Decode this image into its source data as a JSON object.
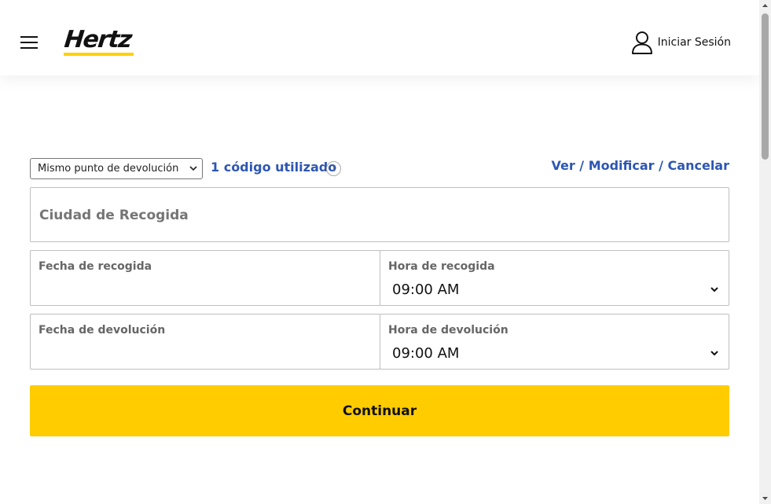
{
  "header": {
    "brand": "Hertz",
    "signin_label": "Iniciar Sesión"
  },
  "booking": {
    "return_option": "Mismo punto de devolución",
    "codes_used": "1 código utilizado",
    "manage_link": "Ver / Modificar / Cancelar",
    "pickup_city_placeholder": "Ciudad de Recogida",
    "pickup_date_label": "Fecha de recogida",
    "pickup_time_label": "Hora de recogida",
    "pickup_time_value": "09:00 AM",
    "return_date_label": "Fecha de devolución",
    "return_time_label": "Hora de devolución",
    "return_time_value": "09:00 AM",
    "continue_label": "Continuar"
  },
  "colors": {
    "brand_yellow": "#ffcc00",
    "link_blue": "#2d56b3"
  },
  "icons": [
    "menu-icon",
    "user-icon",
    "info-icon",
    "chevron-down-icon"
  ]
}
